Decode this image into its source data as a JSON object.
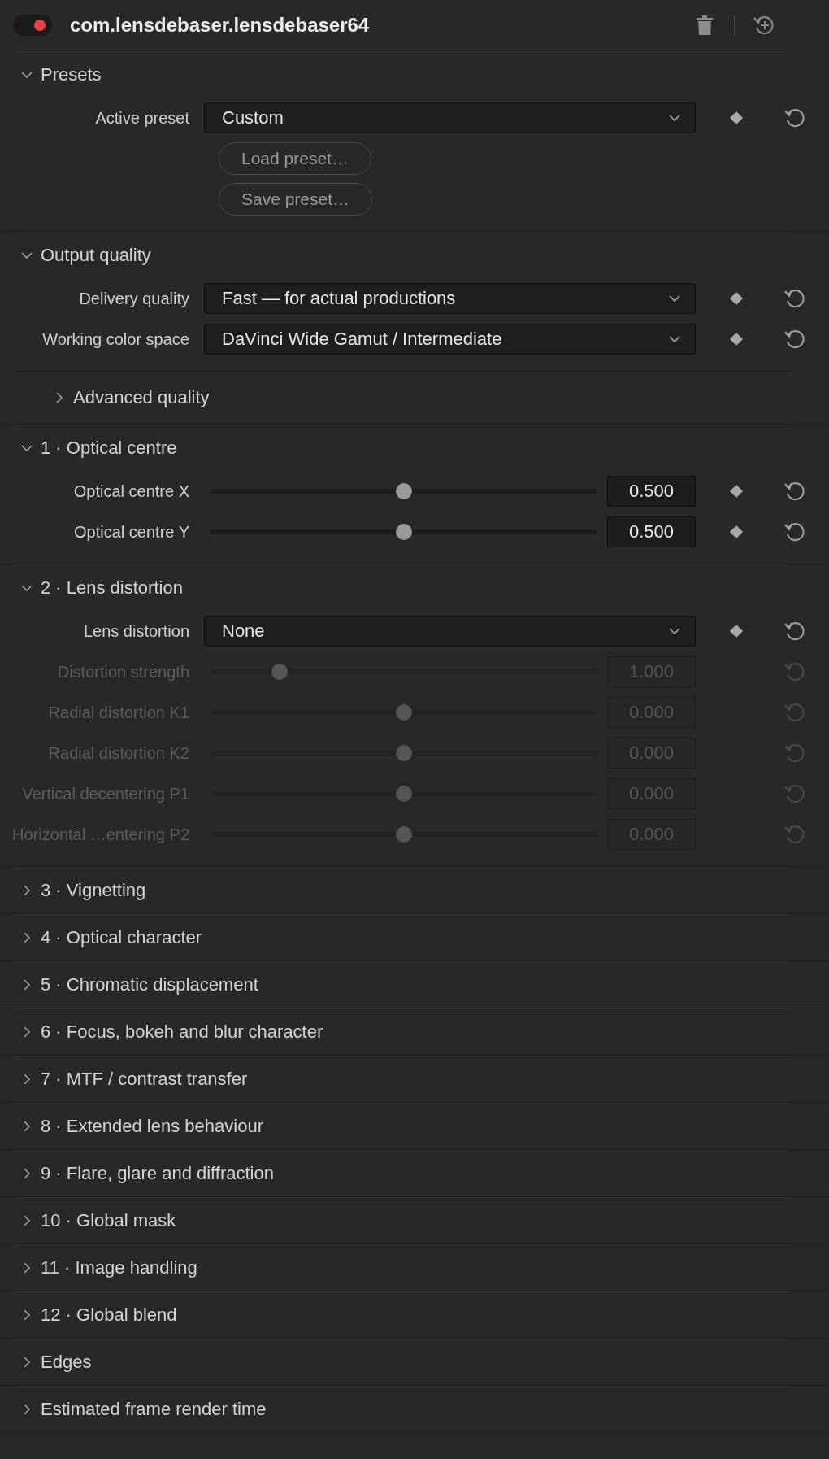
{
  "header": {
    "title": "com.lensdebaser.lensdebaser64",
    "enabled": true
  },
  "sections": [
    {
      "title": "Presets",
      "expanded": true,
      "rows": [
        {
          "kind": "dropdown",
          "label": "Active preset",
          "value": "Custom",
          "disabled": false
        },
        {
          "kind": "button",
          "text": "Load preset…"
        },
        {
          "kind": "button",
          "text": "Save preset…"
        }
      ]
    },
    {
      "title": "Output quality",
      "expanded": true,
      "rows": [
        {
          "kind": "dropdown",
          "label": "Delivery quality",
          "value": "Fast — for actual productions",
          "disabled": false
        },
        {
          "kind": "dropdown",
          "label": "Working color space",
          "value": "DaVinci Wide Gamut / Intermediate",
          "disabled": false
        }
      ],
      "subsections": [
        {
          "title": "Advanced quality",
          "expanded": false
        }
      ]
    },
    {
      "title": "1 · Optical centre",
      "expanded": true,
      "rows": [
        {
          "kind": "slider",
          "label": "Optical centre X",
          "level": 0.5,
          "value": "0.500",
          "disabled": false
        },
        {
          "kind": "slider",
          "label": "Optical centre Y",
          "level": 0.5,
          "value": "0.500",
          "disabled": false
        }
      ]
    },
    {
      "title": "2 · Lens distortion",
      "expanded": true,
      "rows": [
        {
          "kind": "dropdown",
          "label": "Lens distortion",
          "value": "None",
          "disabled": false
        },
        {
          "kind": "slider",
          "label": "Distortion strength",
          "level": 0.165,
          "value": "1.000",
          "disabled": true
        },
        {
          "kind": "slider",
          "label": "Radial distortion K1",
          "level": 0.5,
          "value": "0.000",
          "disabled": true
        },
        {
          "kind": "slider",
          "label": "Radial distortion K2",
          "level": 0.5,
          "value": "0.000",
          "disabled": true
        },
        {
          "kind": "slider",
          "label": "Vertical decentering P1",
          "level": 0.5,
          "value": "0.000",
          "disabled": true
        },
        {
          "kind": "slider",
          "label": "Horizontal …entering P2",
          "level": 0.5,
          "value": "0.000",
          "disabled": true
        }
      ]
    },
    {
      "title": "3 · Vignetting",
      "expanded": false
    },
    {
      "title": "4 · Optical character",
      "expanded": false
    },
    {
      "title": "5 · Chromatic displacement",
      "expanded": false
    },
    {
      "title": "6 · Focus, bokeh and blur character",
      "expanded": false
    },
    {
      "title": "7 · MTF / contrast transfer",
      "expanded": false
    },
    {
      "title": "8 · Extended lens behaviour",
      "expanded": false
    },
    {
      "title": "9 · Flare, glare and diffraction",
      "expanded": false
    },
    {
      "title": "10 · Global mask",
      "expanded": false
    },
    {
      "title": "11 · Image handling",
      "expanded": false
    },
    {
      "title": "12 · Global blend",
      "expanded": false
    },
    {
      "title": "Edges",
      "expanded": false
    },
    {
      "title": "Estimated frame render time",
      "expanded": false
    }
  ]
}
